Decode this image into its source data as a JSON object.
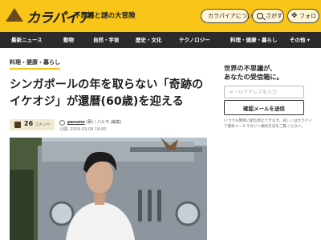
{
  "header": {
    "logo_text": "カラパイア",
    "tagline": "不思議と謎の大冒険",
    "about_label": "カラパイアについて",
    "search_label": "さがす",
    "follow_label": "フォロ"
  },
  "nav": {
    "items": [
      "最新ニュース",
      "動物",
      "自然・宇宙",
      "歴史・文化",
      "テクノロジー",
      "料理・健康・暮らし",
      "その他 ▾"
    ]
  },
  "article": {
    "category": "料理・健康・暮らし",
    "title": "シンガポールの年を取らない「奇跡のイケオジ」が還暦(60歳)を迎える",
    "comment_count": "26",
    "comment_label": "コメント",
    "author_name": "parumo",
    "author_line": "(著) / パルモ (編集)",
    "published": "公開: 2026-03-09 18:00"
  },
  "sidebar": {
    "title_line1": "世界の不思議が、",
    "title_line2": "あなたの受信箱に。",
    "email_placeholder": "メールアドレスを入力",
    "confirm_button": "確認メールを送信",
    "note": "いつでも簡単に配信停止できます。詳しくはカラパイア無料メールマガジン規約方法をご覧ください。"
  },
  "colors": {
    "brand_yellow": "#f9c519",
    "nav_dark": "#2b2b2b",
    "logo_brown": "#6b4a1e"
  }
}
